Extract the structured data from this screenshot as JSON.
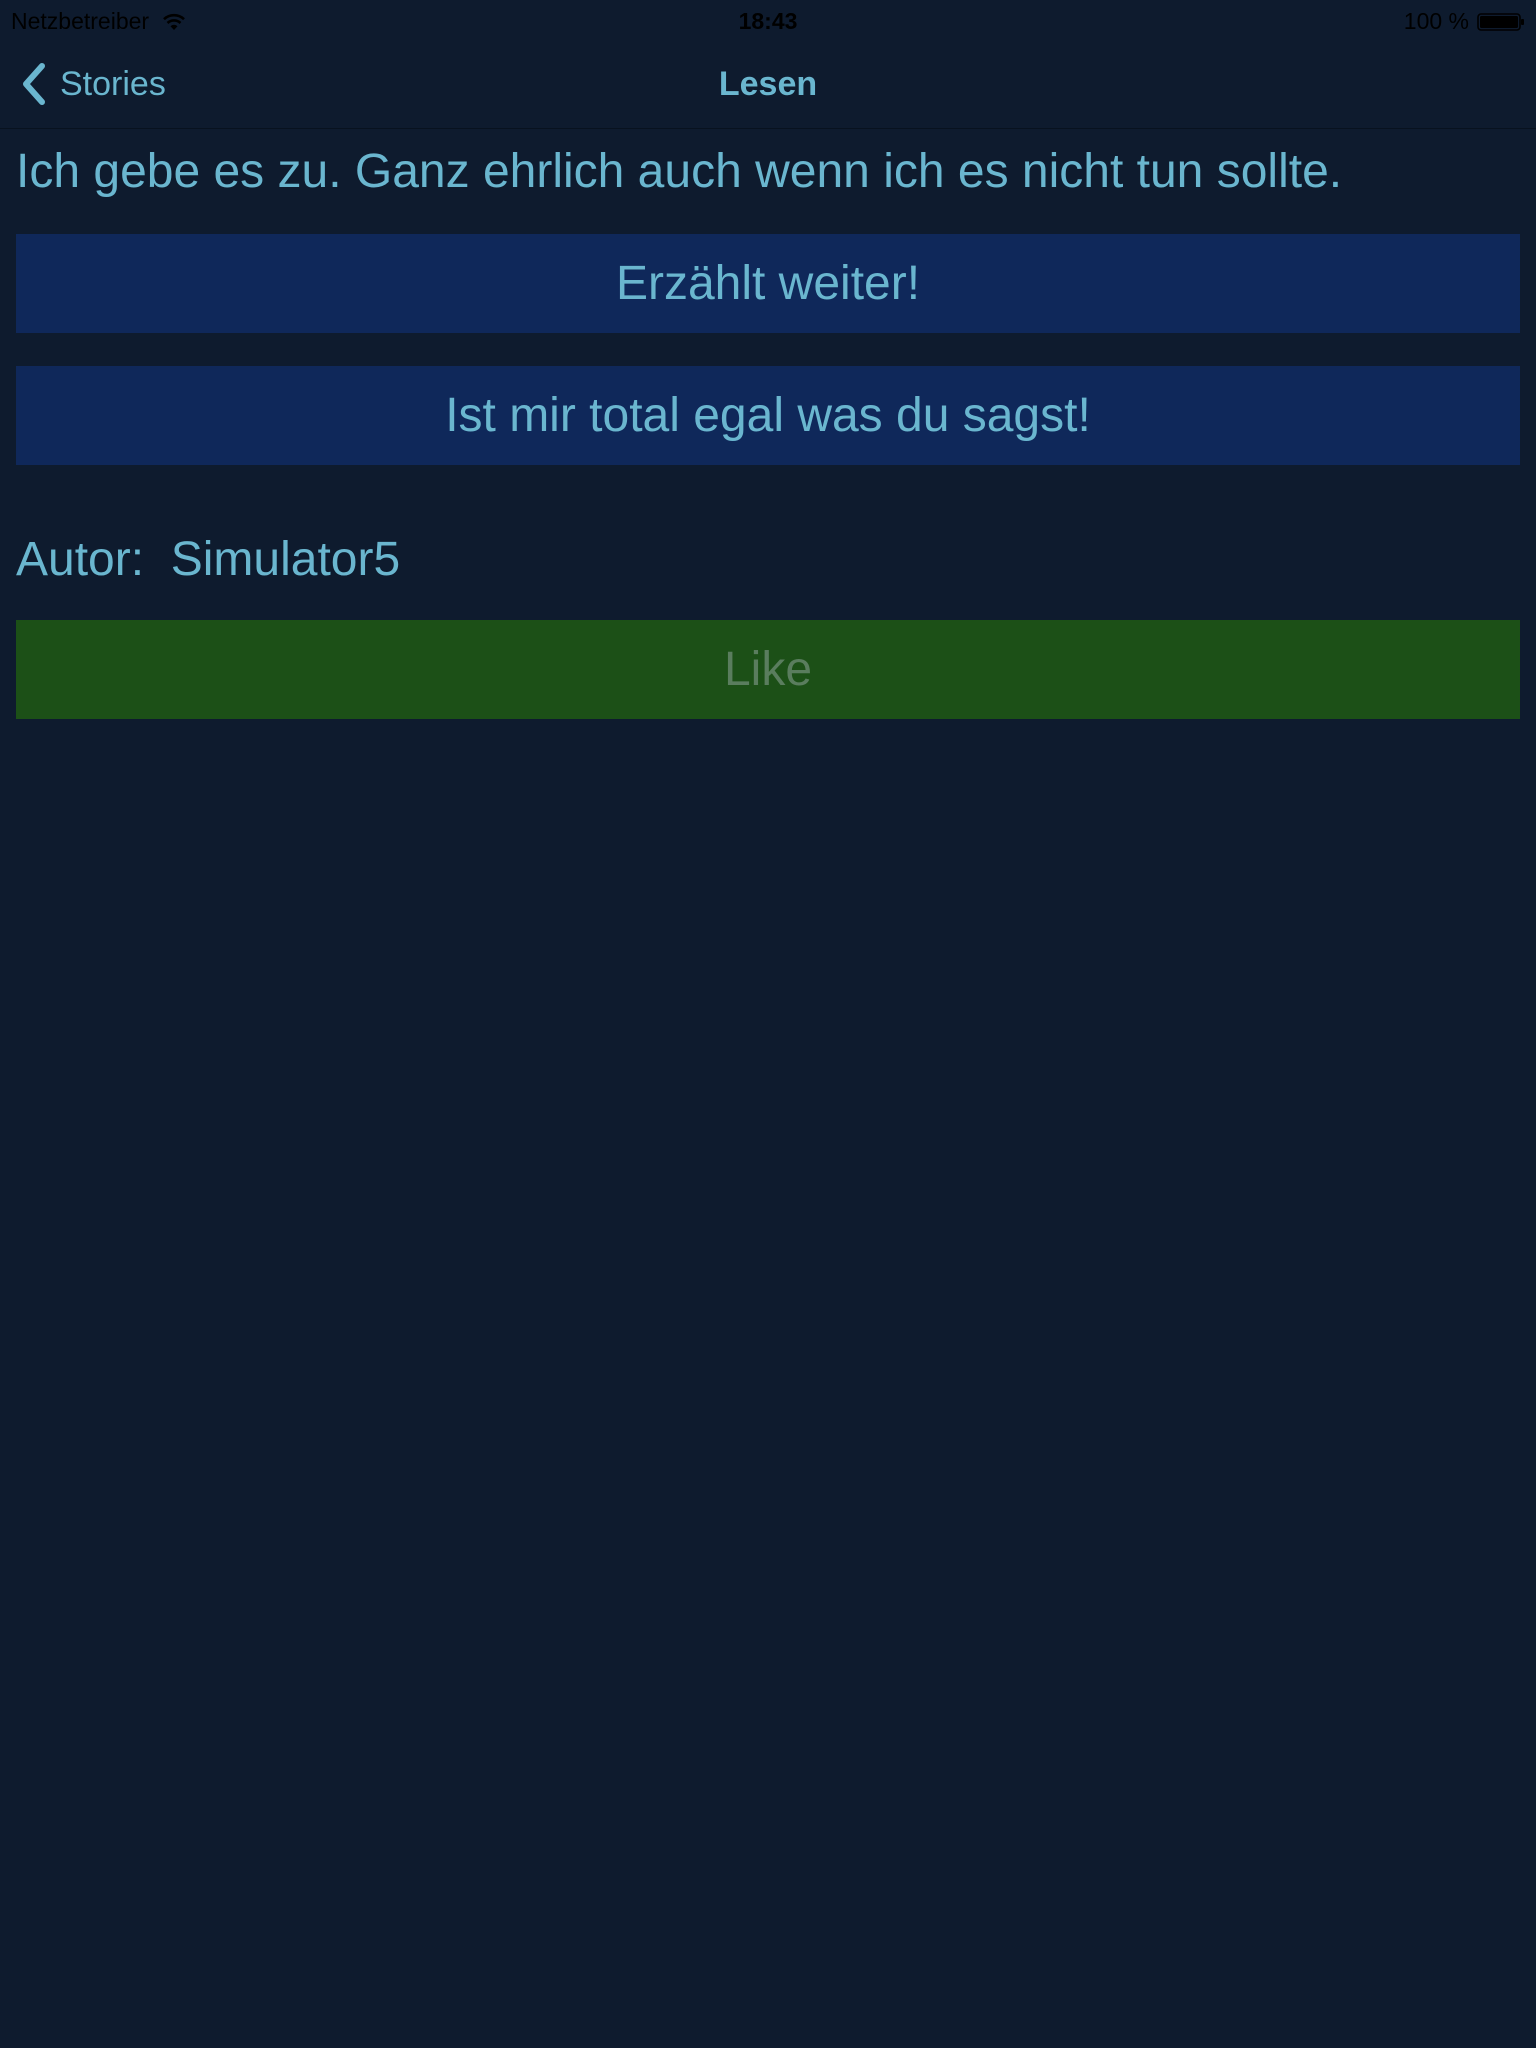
{
  "status_bar": {
    "carrier": "Netzbetreiber",
    "time": "18:43",
    "battery": "100 %"
  },
  "nav": {
    "back_label": "Stories",
    "title": "Lesen"
  },
  "story": {
    "text": "Ich gebe es zu. Ganz ehrlich auch wenn ich es nicht tun sollte."
  },
  "choices": [
    {
      "label": "Erzählt weiter!"
    },
    {
      "label": "Ist mir total egal was du sagst!"
    }
  ],
  "author": {
    "label": "Autor:",
    "name": "Simulator5"
  },
  "like": {
    "label": "Like"
  },
  "colors": {
    "background": "#0e1b2e",
    "accent_text": "#6ab6cf",
    "choice_button": "#0f285a",
    "like_button": "#1c5017",
    "like_text": "#5a7d5e"
  },
  "icons": {
    "back": "chevron-left-icon",
    "wifi": "wifi-icon",
    "battery": "battery-icon"
  }
}
